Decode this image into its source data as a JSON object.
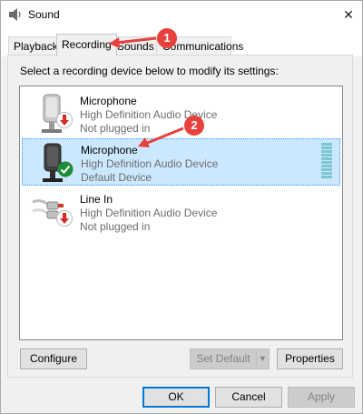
{
  "window": {
    "title": "Sound",
    "close_glyph": "✕"
  },
  "tabs": [
    {
      "label": "Playback"
    },
    {
      "label": "Recording"
    },
    {
      "label": "Sounds"
    },
    {
      "label": "Communications"
    }
  ],
  "instruction": "Select a recording device below to modify its settings:",
  "devices": [
    {
      "name": "Microphone",
      "description": "High Definition Audio Device",
      "status": "Not plugged in",
      "icon": "microphone-icon",
      "badge": "red-down-arrow-icon"
    },
    {
      "name": "Microphone",
      "description": "High Definition Audio Device",
      "status": "Default Device",
      "icon": "microphone-icon",
      "badge": "green-check-icon"
    },
    {
      "name": "Line In",
      "description": "High Definition Audio Device",
      "status": "Not plugged in",
      "icon": "line-in-cable-icon",
      "badge": "red-down-arrow-icon"
    }
  ],
  "buttons": {
    "configure": "Configure",
    "set_default": "Set Default",
    "properties": "Properties",
    "ok": "OK",
    "cancel": "Cancel",
    "apply": "Apply"
  },
  "annotations": [
    {
      "number": "1"
    },
    {
      "number": "2"
    }
  ],
  "colors": {
    "selection": "#cce8ff",
    "badge_red": "#e8403c",
    "check_green": "#1e8a3a",
    "meter": "#7cc7d2"
  }
}
